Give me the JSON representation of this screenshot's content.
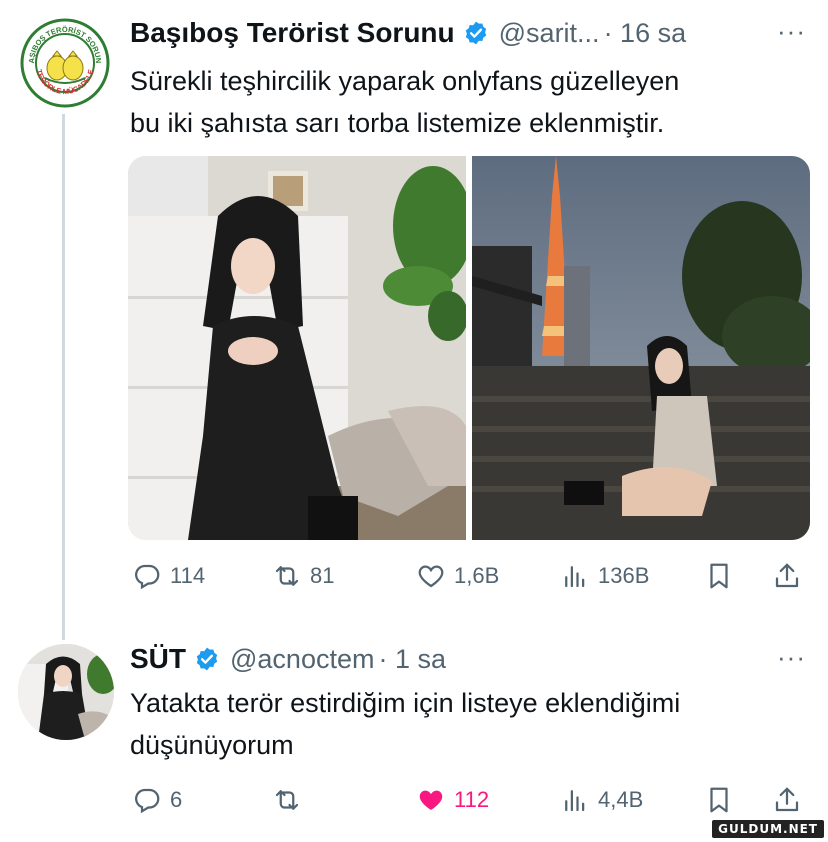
{
  "tweet1": {
    "name": "Başıboş Terörist Sorunu",
    "handle": "@sarit...",
    "time": "· 16 sa",
    "text_line1": "Sürekli teşhircilik yaparak onlyfans güzelleyen",
    "text_line2": "bu iki şahısta sarı torba listemize eklenmiştir.",
    "avatar_text_top": "BAŞIBOŞ TERÖRİST SORUNU",
    "avatar_text_bottom": "TERÖRLE MÜCADELE",
    "stats": {
      "replies": "114",
      "retweets": "81",
      "likes": "1,6B",
      "views": "136B"
    }
  },
  "tweet2": {
    "name": "SÜT",
    "handle": "@acnoctem",
    "time": "· 1 sa",
    "text_line1": "Yatakta terör estirdiğim için listeye eklendiğimi",
    "text_line2": "düşünüyorum",
    "stats": {
      "replies": "6",
      "retweets": "",
      "likes": "112",
      "views": "4,4B"
    },
    "liked": true
  },
  "watermark": "GULDUM.NET",
  "more_glyph": "···",
  "colors": {
    "verified": "#1d9bf0",
    "like_active": "#f91880",
    "muted": "#536471",
    "thread_line": "#cfd9de"
  },
  "icons": [
    "reply-icon",
    "retweet-icon",
    "like-icon",
    "views-icon",
    "bookmark-icon",
    "share-icon",
    "verified-badge-icon",
    "more-icon"
  ]
}
